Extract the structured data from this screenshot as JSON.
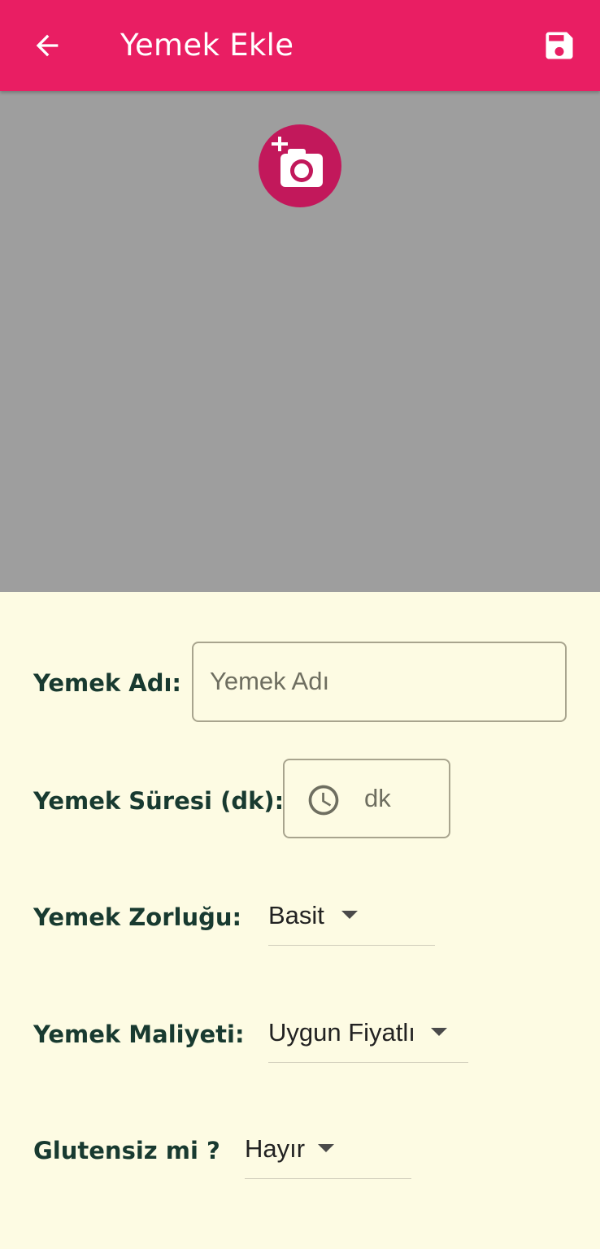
{
  "appbar": {
    "title": "Yemek Ekle",
    "back_icon": "arrow-back-icon",
    "save_icon": "save-icon",
    "color": "#e91e63"
  },
  "photo": {
    "icon": "add-photo-icon",
    "background": "#9e9e9e",
    "button_color": "#c2185b"
  },
  "form": {
    "name": {
      "label": "Yemek Adı:",
      "placeholder": "Yemek Adı"
    },
    "duration": {
      "label": "Yemek Süresi (dk):",
      "placeholder": "dk",
      "icon": "clock-icon"
    },
    "difficulty": {
      "label": "Yemek Zorluğu:",
      "value": "Basit"
    },
    "cost": {
      "label": "Yemek Maliyeti:",
      "value": "Uygun Fiyatlı"
    },
    "gluten_free": {
      "label": "Glutensiz mi ?",
      "value": "Hayır"
    }
  }
}
